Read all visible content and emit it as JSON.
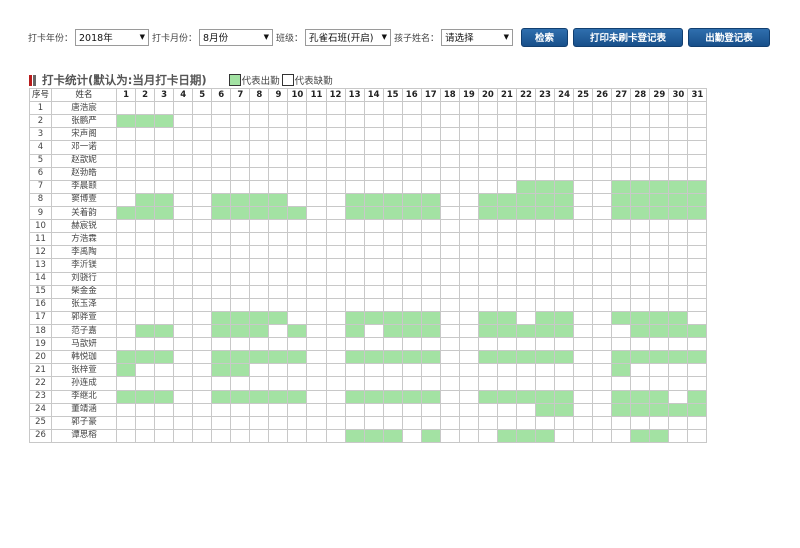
{
  "filters": {
    "year_label": "打卡年份：",
    "year_value": "2018年",
    "month_label": "打卡月份：",
    "month_value": "8月份",
    "class_label": "班级：",
    "class_value": "孔雀石班(开启)",
    "child_label": "孩子姓名：",
    "child_value": "请选择"
  },
  "buttons": {
    "search": "检索",
    "print_missing": "打印未刷卡登记表",
    "attendance_sheet": "出勤登记表"
  },
  "section": {
    "title": "打卡统计(默认为:当月打卡日期)",
    "legend_present": "代表出勤",
    "legend_absent": "代表缺勤"
  },
  "colors": {
    "present": "#a3e2a3",
    "absent": "#ffffff",
    "button": "#1f5a96",
    "title_bar": "#b81c1c"
  },
  "table": {
    "col_no": "序号",
    "col_name": "姓名",
    "days": [
      "1",
      "2",
      "3",
      "4",
      "5",
      "6",
      "7",
      "8",
      "9",
      "10",
      "11",
      "12",
      "13",
      "14",
      "15",
      "16",
      "17",
      "18",
      "19",
      "20",
      "21",
      "22",
      "23",
      "24",
      "25",
      "26",
      "27",
      "28",
      "29",
      "30",
      "31"
    ],
    "rows": [
      {
        "no": "1",
        "name": "唐浩宸",
        "present": []
      },
      {
        "no": "2",
        "name": "张鹏严",
        "present": [
          1,
          2,
          3
        ]
      },
      {
        "no": "3",
        "name": "宋声阁",
        "present": []
      },
      {
        "no": "4",
        "name": "邓一诺",
        "present": []
      },
      {
        "no": "5",
        "name": "赵歆妮",
        "present": []
      },
      {
        "no": "6",
        "name": "赵勃皓",
        "present": []
      },
      {
        "no": "7",
        "name": "李晨颐",
        "present": [
          22,
          23,
          24,
          27,
          28,
          29,
          30,
          31
        ]
      },
      {
        "no": "8",
        "name": "窦博壹",
        "present": [
          2,
          3,
          6,
          7,
          8,
          9,
          13,
          14,
          15,
          16,
          17,
          20,
          21,
          22,
          23,
          24,
          27,
          28,
          29,
          30,
          31
        ]
      },
      {
        "no": "9",
        "name": "关着韵",
        "present": [
          1,
          2,
          3,
          6,
          7,
          8,
          9,
          10,
          13,
          14,
          15,
          16,
          17,
          20,
          21,
          22,
          23,
          24,
          27,
          28,
          29,
          30,
          31
        ]
      },
      {
        "no": "10",
        "name": "赫宸锐",
        "present": []
      },
      {
        "no": "11",
        "name": "方浩霖",
        "present": []
      },
      {
        "no": "12",
        "name": "李禹陶",
        "present": []
      },
      {
        "no": "13",
        "name": "李沂镁",
        "present": []
      },
      {
        "no": "14",
        "name": "刘骁行",
        "present": []
      },
      {
        "no": "15",
        "name": "柴金金",
        "present": []
      },
      {
        "no": "16",
        "name": "张玉泽",
        "present": []
      },
      {
        "no": "17",
        "name": "郭骅萱",
        "present": [
          6,
          7,
          8,
          9,
          13,
          14,
          15,
          16,
          17,
          20,
          21,
          23,
          24,
          27,
          28,
          29,
          30
        ]
      },
      {
        "no": "18",
        "name": "范子嘉",
        "present": [
          2,
          3,
          6,
          7,
          8,
          10,
          13,
          15,
          16,
          17,
          20,
          21,
          22,
          23,
          24,
          28,
          29,
          30,
          31
        ]
      },
      {
        "no": "19",
        "name": "马歆妍",
        "present": []
      },
      {
        "no": "20",
        "name": "韩悦珈",
        "present": [
          1,
          2,
          3,
          6,
          7,
          8,
          9,
          10,
          13,
          14,
          15,
          16,
          17,
          20,
          21,
          22,
          23,
          24,
          27,
          28,
          29,
          30,
          31
        ]
      },
      {
        "no": "21",
        "name": "张梓萱",
        "present": [
          1,
          6,
          7,
          27
        ]
      },
      {
        "no": "22",
        "name": "孙连成",
        "present": []
      },
      {
        "no": "23",
        "name": "李继北",
        "present": [
          1,
          2,
          3,
          6,
          7,
          8,
          9,
          10,
          13,
          14,
          15,
          16,
          17,
          20,
          21,
          22,
          23,
          24,
          27,
          28,
          29,
          31
        ]
      },
      {
        "no": "24",
        "name": "董靖涵",
        "present": [
          23,
          24,
          27,
          28,
          29,
          30,
          31
        ]
      },
      {
        "no": "25",
        "name": "郭子豪",
        "present": []
      },
      {
        "no": "26",
        "name": "谭思榕",
        "present": [
          13,
          14,
          15,
          17,
          21,
          22,
          23,
          28,
          29
        ]
      }
    ]
  }
}
